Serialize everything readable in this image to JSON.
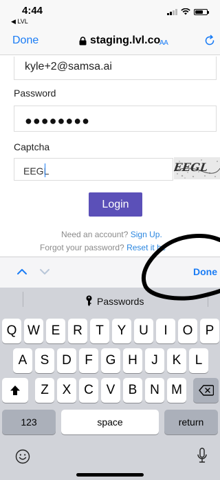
{
  "status_bar": {
    "time": "4:44",
    "back_app": "◀ LVL"
  },
  "browser": {
    "done_label": "Done",
    "url": "staging.lvl.co",
    "text_size_label": "AA"
  },
  "form": {
    "email_value": "kyle+2@samsa.ai",
    "password_label": "Password",
    "password_value": "●●●●●●●●",
    "captcha_label": "Captcha",
    "captcha_value": "EEGL",
    "captcha_image_text": "EEGL",
    "login_label": "Login",
    "signup_prompt": "Need an account?",
    "signup_link": "Sign Up.",
    "forgot_prompt": "Forgot your password?",
    "reset_link": "Reset it he"
  },
  "keyboard_toolbar": {
    "done_label": "Done"
  },
  "keyboard": {
    "suggestion": "Passwords",
    "row1": [
      "Q",
      "W",
      "E",
      "R",
      "T",
      "Y",
      "U",
      "I",
      "O",
      "P"
    ],
    "row2": [
      "A",
      "S",
      "D",
      "F",
      "G",
      "H",
      "J",
      "K",
      "L"
    ],
    "row3": [
      "Z",
      "X",
      "C",
      "V",
      "B",
      "N",
      "M"
    ],
    "numbers_label": "123",
    "space_label": "space",
    "return_label": "return"
  },
  "colors": {
    "accent": "#1a7cf5",
    "login_button": "#5b50b8",
    "keyboard_bg": "#d1d3d9"
  }
}
